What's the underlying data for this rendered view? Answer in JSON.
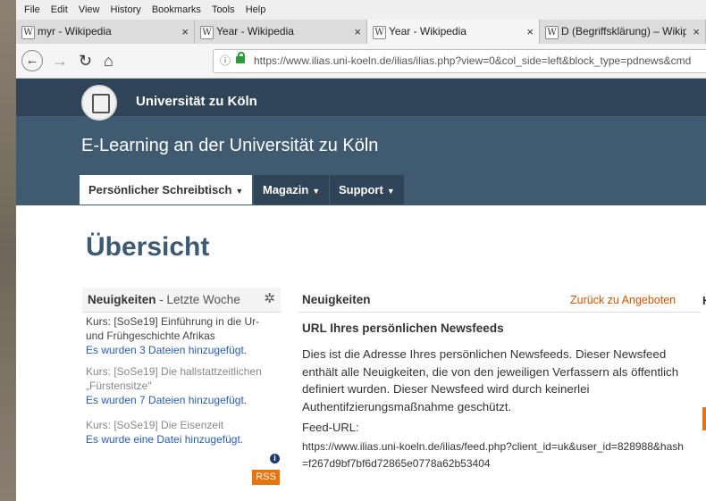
{
  "menu": [
    "File",
    "Edit",
    "View",
    "History",
    "Bookmarks",
    "Tools",
    "Help"
  ],
  "tabs": [
    {
      "label": "myr - Wikipedia",
      "close": "×"
    },
    {
      "label": "Year - Wikipedia",
      "close": "×"
    },
    {
      "label": "Year - Wikipedia",
      "close": "×"
    },
    {
      "label": "D (Begriffsklärung) – Wikipedia",
      "close": "×"
    }
  ],
  "tab_icon": "W",
  "url": "https://www.ilias.uni-koeln.de/ilias/ilias.php?view=0&col_side=left&block_type=pdnews&cmd",
  "header": {
    "university": "Universität zu Köln",
    "platform": "E-Learning an der Universität zu Köln",
    "nav": [
      "Persönlicher Schreibtisch",
      "Magazin",
      "Support"
    ]
  },
  "page_title": "Übersicht",
  "sidebar": {
    "title": "Neuigkeiten",
    "subtitle": " - Letzte Woche",
    "items": [
      {
        "course": "Kurs: [SoSe19] Einführung in die Ur- und Frühgeschichte Afrikas",
        "link": "Es wurden 3 Dateien hinzugefügt."
      },
      {
        "course": "Kurs: [SoSe19] Die hallstattzeitlichen „Fürstensitze\"",
        "link": "Es wurden 7 Dateien hinzugefügt."
      },
      {
        "course": "Kurs: [SoSe19] Die Eisenzeit",
        "link": "Es wurde eine Datei hinzugefügt."
      }
    ],
    "info": "i",
    "rss": "RSS"
  },
  "main": {
    "title": "Neuigkeiten",
    "back_link": "Zurück zu Angeboten",
    "heading": "URL Ihres persönlichen Newsfeeds",
    "description": "Dies ist die Adresse Ihres persönlichen Newsfeeds. Dieser Newsfeed enthält alle Neuigkeiten, die von den jeweiligen Verfassern als öffentlich definiert wurden. Dieser Newsfeed wird durch keinerlei Authentifzierungsmaßnahme geschützt.",
    "feed_label": "Feed-URL:",
    "feed_url": "https://www.ilias.uni-koeln.de/ilias/feed.php?client_id=uk&user_id=828988&hash=f267d9bf7bf6d72865e0778a62b53404"
  },
  "cut_column_letter": "K"
}
